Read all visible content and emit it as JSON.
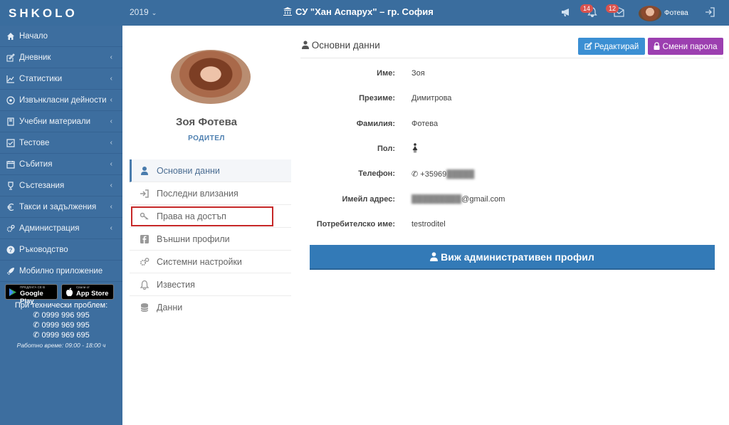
{
  "header": {
    "logo": "SHKOLO",
    "year": "2019",
    "school": "СУ \"Хан Аспарух\" – гр. София",
    "notifications_count": "14",
    "messages_count": "12",
    "user_name": "Фотева"
  },
  "sidebar": {
    "items": [
      {
        "label": "Начало",
        "icon": "home-icon"
      },
      {
        "label": "Дневник",
        "icon": "edit-icon"
      },
      {
        "label": "Статистики",
        "icon": "chart-icon"
      },
      {
        "label": "Извънкласни дейности",
        "icon": "ball-icon"
      },
      {
        "label": "Учебни материали",
        "icon": "book-icon"
      },
      {
        "label": "Тестове",
        "icon": "check-square-icon"
      },
      {
        "label": "Събития",
        "icon": "calendar-icon"
      },
      {
        "label": "Състезания",
        "icon": "trophy-icon"
      },
      {
        "label": "Такси и задължения",
        "icon": "euro-icon"
      },
      {
        "label": "Администрация",
        "icon": "cogs-icon"
      },
      {
        "label": "Ръководство",
        "icon": "question-icon"
      },
      {
        "label": "Мобилно приложение",
        "icon": "rocket-icon"
      }
    ],
    "google_play_small": "ПРЕДЛАГА СЕ В",
    "google_play": "Google Play",
    "app_store_small": "Свали от",
    "app_store": "App Store",
    "support_title": "При технически проблем:",
    "phone1": "0999 996 995",
    "phone2": "0999 969 995",
    "phone3": "0999 969 695",
    "hours": "Работно време: 09:00 - 18:00 ч"
  },
  "profile": {
    "name": "Зоя Фотева",
    "role": "РОДИТЕЛ",
    "menu": [
      {
        "label": "Основни данни",
        "icon": "user-icon"
      },
      {
        "label": "Последни влизания",
        "icon": "sign-in-icon"
      },
      {
        "label": "Права на достъп",
        "icon": "key-icon"
      },
      {
        "label": "Външни профили",
        "icon": "facebook-icon"
      },
      {
        "label": "Системни настройки",
        "icon": "cogs-icon"
      },
      {
        "label": "Известия",
        "icon": "bell-icon"
      },
      {
        "label": "Данни",
        "icon": "database-icon"
      }
    ]
  },
  "main": {
    "title": "Основни данни",
    "edit_label": "Редактирай",
    "change_password_label": "Смени парола",
    "fields": [
      {
        "label": "Име:",
        "value": "Зоя"
      },
      {
        "label": "Презиме:",
        "value": "Димитрова"
      },
      {
        "label": "Фамилия:",
        "value": "Фотева"
      },
      {
        "label": "Пол:",
        "value": ""
      },
      {
        "label": "Телефон:",
        "value": "+35969"
      },
      {
        "label": "Имейл адрес:",
        "value": "@gmail.com"
      },
      {
        "label": "Потребителско име:",
        "value": "testroditel"
      }
    ],
    "admin_profile_label": "Виж административен профил"
  }
}
